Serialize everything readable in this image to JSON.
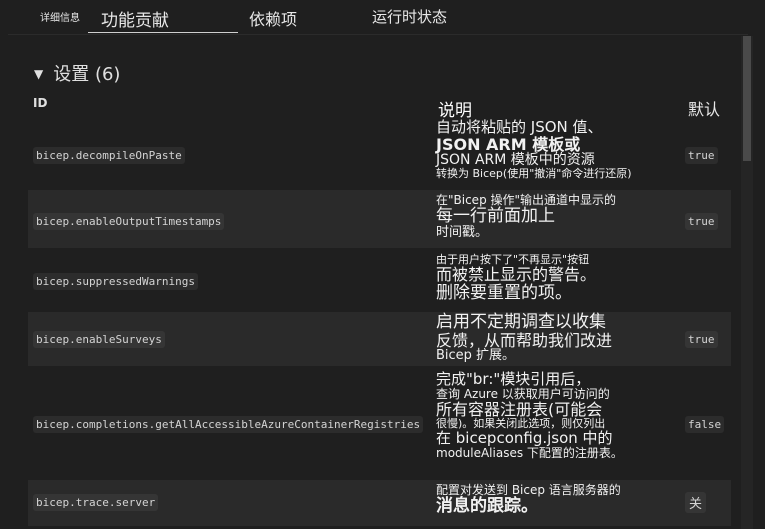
{
  "tabs": {
    "details": "详细信息",
    "contributions": "功能贡献",
    "dependencies": "依赖项",
    "runtime": "运行时状态"
  },
  "section": {
    "title": "设置 (6)",
    "collapse_glyph": "▼"
  },
  "table": {
    "headers": {
      "id": "ID",
      "description": "说明",
      "default": "默认"
    },
    "rows": [
      {
        "id": "bicep.decompileOnPaste",
        "description": [
          "自动将粘贴的 JSON 值、",
          "JSON ARM 模板或",
          "JSON ARM 模板中的资源",
          "转换为 Bicep(使用\"撤消\"命令进行还原)"
        ],
        "default": "true"
      },
      {
        "id": "bicep.enableOutputTimestamps",
        "description": [
          "在\"Bicep 操作\"输出通道中显示的",
          "每一行前面加上",
          "时间戳。"
        ],
        "default": "true"
      },
      {
        "id": "bicep.suppressedWarnings",
        "description": [
          "由于用户按下了\"不再显示\"按钮",
          "而被禁止显示的警告。",
          "删除要重置的项。"
        ],
        "default": ""
      },
      {
        "id": "bicep.enableSurveys",
        "description": [
          "启用不定期调查以收集",
          "反馈，从而帮助我们改进",
          "Bicep 扩展。"
        ],
        "default": "true"
      },
      {
        "id": "bicep.completions.getAllAccessibleAzureContainerRegistries",
        "description": [
          "完成\"br:\"模块引用后，",
          "查询 Azure 以获取用户可访问的",
          "所有容器注册表(可能会",
          "很慢)。如果关闭此选项，则仅列出",
          "在 bicepconfig.json 中的",
          "moduleAliases 下配置的注册表。"
        ],
        "default": "false"
      },
      {
        "id": "bicep.trace.server",
        "description": [
          "配置对发送到 Bicep 语言服务器的",
          "消息的跟踪。"
        ],
        "default": "关"
      }
    ]
  }
}
